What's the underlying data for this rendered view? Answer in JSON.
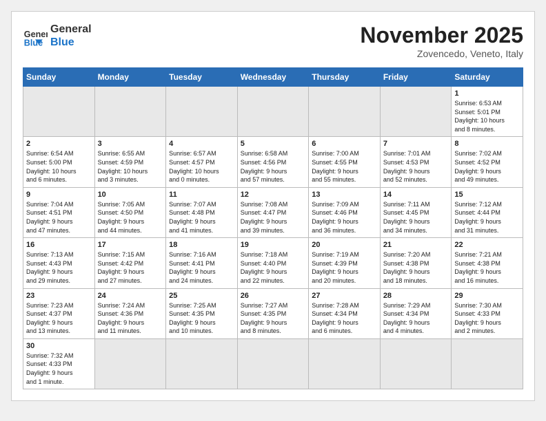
{
  "logo": {
    "text_general": "General",
    "text_blue": "Blue"
  },
  "header": {
    "month": "November 2025",
    "location": "Zovencedo, Veneto, Italy"
  },
  "weekdays": [
    "Sunday",
    "Monday",
    "Tuesday",
    "Wednesday",
    "Thursday",
    "Friday",
    "Saturday"
  ],
  "weeks": [
    [
      {
        "num": "",
        "empty": true,
        "info": ""
      },
      {
        "num": "",
        "empty": true,
        "info": ""
      },
      {
        "num": "",
        "empty": true,
        "info": ""
      },
      {
        "num": "",
        "empty": true,
        "info": ""
      },
      {
        "num": "",
        "empty": true,
        "info": ""
      },
      {
        "num": "",
        "empty": true,
        "info": ""
      },
      {
        "num": "1",
        "empty": false,
        "info": "Sunrise: 6:53 AM\nSunset: 5:01 PM\nDaylight: 10 hours\nand 8 minutes."
      }
    ],
    [
      {
        "num": "2",
        "empty": false,
        "info": "Sunrise: 6:54 AM\nSunset: 5:00 PM\nDaylight: 10 hours\nand 6 minutes."
      },
      {
        "num": "3",
        "empty": false,
        "info": "Sunrise: 6:55 AM\nSunset: 4:59 PM\nDaylight: 10 hours\nand 3 minutes."
      },
      {
        "num": "4",
        "empty": false,
        "info": "Sunrise: 6:57 AM\nSunset: 4:57 PM\nDaylight: 10 hours\nand 0 minutes."
      },
      {
        "num": "5",
        "empty": false,
        "info": "Sunrise: 6:58 AM\nSunset: 4:56 PM\nDaylight: 9 hours\nand 57 minutes."
      },
      {
        "num": "6",
        "empty": false,
        "info": "Sunrise: 7:00 AM\nSunset: 4:55 PM\nDaylight: 9 hours\nand 55 minutes."
      },
      {
        "num": "7",
        "empty": false,
        "info": "Sunrise: 7:01 AM\nSunset: 4:53 PM\nDaylight: 9 hours\nand 52 minutes."
      },
      {
        "num": "8",
        "empty": false,
        "info": "Sunrise: 7:02 AM\nSunset: 4:52 PM\nDaylight: 9 hours\nand 49 minutes."
      }
    ],
    [
      {
        "num": "9",
        "empty": false,
        "info": "Sunrise: 7:04 AM\nSunset: 4:51 PM\nDaylight: 9 hours\nand 47 minutes."
      },
      {
        "num": "10",
        "empty": false,
        "info": "Sunrise: 7:05 AM\nSunset: 4:50 PM\nDaylight: 9 hours\nand 44 minutes."
      },
      {
        "num": "11",
        "empty": false,
        "info": "Sunrise: 7:07 AM\nSunset: 4:48 PM\nDaylight: 9 hours\nand 41 minutes."
      },
      {
        "num": "12",
        "empty": false,
        "info": "Sunrise: 7:08 AM\nSunset: 4:47 PM\nDaylight: 9 hours\nand 39 minutes."
      },
      {
        "num": "13",
        "empty": false,
        "info": "Sunrise: 7:09 AM\nSunset: 4:46 PM\nDaylight: 9 hours\nand 36 minutes."
      },
      {
        "num": "14",
        "empty": false,
        "info": "Sunrise: 7:11 AM\nSunset: 4:45 PM\nDaylight: 9 hours\nand 34 minutes."
      },
      {
        "num": "15",
        "empty": false,
        "info": "Sunrise: 7:12 AM\nSunset: 4:44 PM\nDaylight: 9 hours\nand 31 minutes."
      }
    ],
    [
      {
        "num": "16",
        "empty": false,
        "info": "Sunrise: 7:13 AM\nSunset: 4:43 PM\nDaylight: 9 hours\nand 29 minutes."
      },
      {
        "num": "17",
        "empty": false,
        "info": "Sunrise: 7:15 AM\nSunset: 4:42 PM\nDaylight: 9 hours\nand 27 minutes."
      },
      {
        "num": "18",
        "empty": false,
        "info": "Sunrise: 7:16 AM\nSunset: 4:41 PM\nDaylight: 9 hours\nand 24 minutes."
      },
      {
        "num": "19",
        "empty": false,
        "info": "Sunrise: 7:18 AM\nSunset: 4:40 PM\nDaylight: 9 hours\nand 22 minutes."
      },
      {
        "num": "20",
        "empty": false,
        "info": "Sunrise: 7:19 AM\nSunset: 4:39 PM\nDaylight: 9 hours\nand 20 minutes."
      },
      {
        "num": "21",
        "empty": false,
        "info": "Sunrise: 7:20 AM\nSunset: 4:38 PM\nDaylight: 9 hours\nand 18 minutes."
      },
      {
        "num": "22",
        "empty": false,
        "info": "Sunrise: 7:21 AM\nSunset: 4:38 PM\nDaylight: 9 hours\nand 16 minutes."
      }
    ],
    [
      {
        "num": "23",
        "empty": false,
        "info": "Sunrise: 7:23 AM\nSunset: 4:37 PM\nDaylight: 9 hours\nand 13 minutes."
      },
      {
        "num": "24",
        "empty": false,
        "info": "Sunrise: 7:24 AM\nSunset: 4:36 PM\nDaylight: 9 hours\nand 11 minutes."
      },
      {
        "num": "25",
        "empty": false,
        "info": "Sunrise: 7:25 AM\nSunset: 4:35 PM\nDaylight: 9 hours\nand 10 minutes."
      },
      {
        "num": "26",
        "empty": false,
        "info": "Sunrise: 7:27 AM\nSunset: 4:35 PM\nDaylight: 9 hours\nand 8 minutes."
      },
      {
        "num": "27",
        "empty": false,
        "info": "Sunrise: 7:28 AM\nSunset: 4:34 PM\nDaylight: 9 hours\nand 6 minutes."
      },
      {
        "num": "28",
        "empty": false,
        "info": "Sunrise: 7:29 AM\nSunset: 4:34 PM\nDaylight: 9 hours\nand 4 minutes."
      },
      {
        "num": "29",
        "empty": false,
        "info": "Sunrise: 7:30 AM\nSunset: 4:33 PM\nDaylight: 9 hours\nand 2 minutes."
      }
    ],
    [
      {
        "num": "30",
        "empty": false,
        "info": "Sunrise: 7:32 AM\nSunset: 4:33 PM\nDaylight: 9 hours\nand 1 minute."
      },
      {
        "num": "",
        "empty": true,
        "info": ""
      },
      {
        "num": "",
        "empty": true,
        "info": ""
      },
      {
        "num": "",
        "empty": true,
        "info": ""
      },
      {
        "num": "",
        "empty": true,
        "info": ""
      },
      {
        "num": "",
        "empty": true,
        "info": ""
      },
      {
        "num": "",
        "empty": true,
        "info": ""
      }
    ]
  ]
}
